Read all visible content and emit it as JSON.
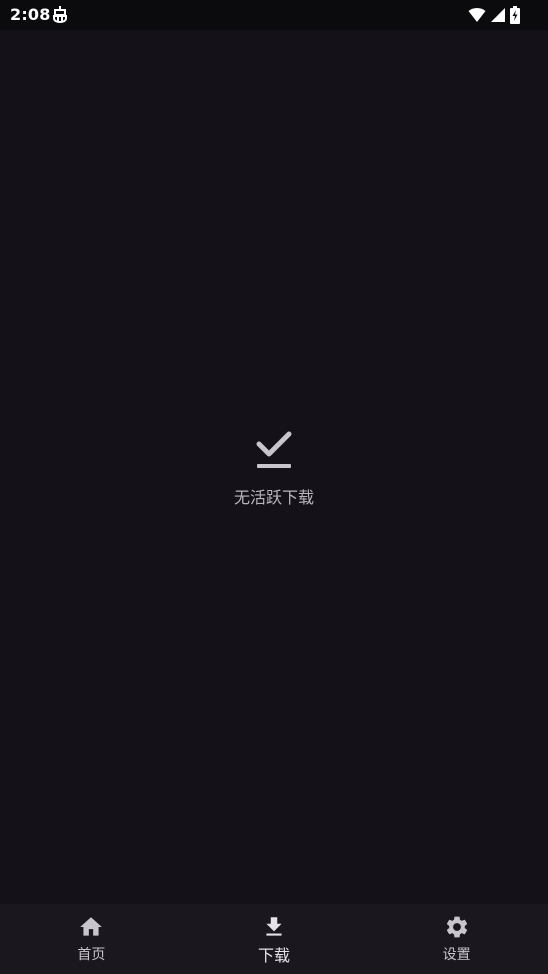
{
  "status_bar": {
    "time": "2:08",
    "app_icon": "android-bug-icon",
    "wifi_icon": "wifi-icon",
    "signal_icon": "cell-signal-icon",
    "battery_icon": "battery-charging-icon"
  },
  "empty_state": {
    "icon": "check-done-icon",
    "message": "无活跃下载"
  },
  "bottom_nav": {
    "items": [
      {
        "label": "首页",
        "icon": "home-icon",
        "active": false
      },
      {
        "label": "下载",
        "icon": "download-icon",
        "active": true
      },
      {
        "label": "设置",
        "icon": "gear-icon",
        "active": false
      }
    ]
  },
  "colors": {
    "background": "#141218",
    "status_bar": "#0b0b0e",
    "nav_bar": "#1a181e",
    "icon": "#c9c5cd",
    "text_muted": "#b9b6bd"
  }
}
